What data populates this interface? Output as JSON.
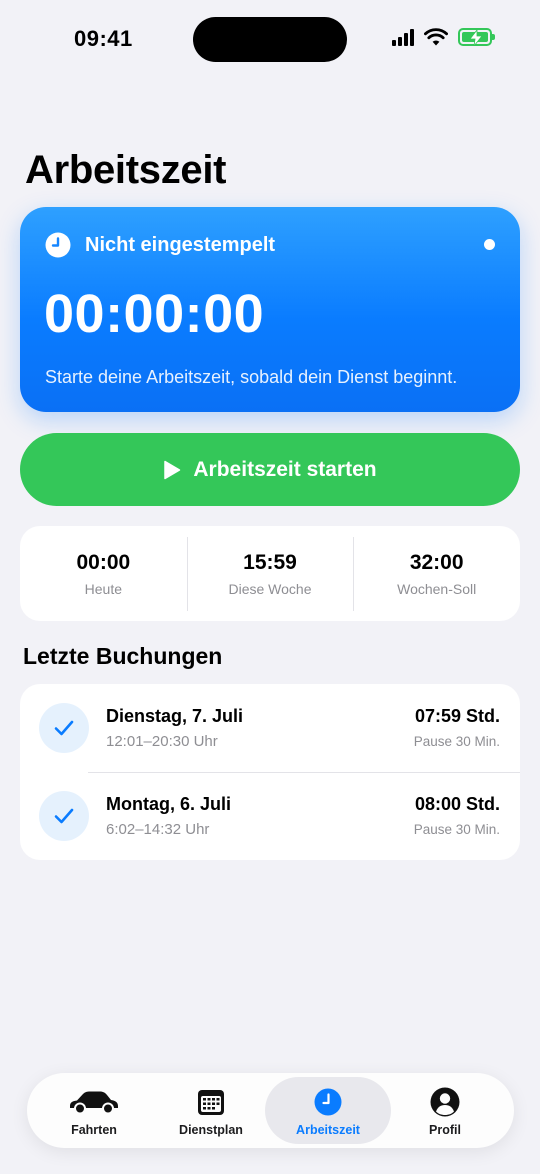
{
  "status_bar": {
    "time": "09:41"
  },
  "page": {
    "title": "Arbeitszeit"
  },
  "timer": {
    "status": "Nicht eingestempelt",
    "value": "00:00:00",
    "hint": "Starte deine Arbeitszeit, sobald dein Dienst beginnt."
  },
  "actions": {
    "start_label": "Arbeitszeit starten"
  },
  "stats": [
    {
      "value": "00:00",
      "label": "Heute"
    },
    {
      "value": "15:59",
      "label": "Diese Woche"
    },
    {
      "value": "32:00",
      "label": "Wochen-Soll"
    }
  ],
  "bookings": {
    "title": "Letzte Buchungen",
    "items": [
      {
        "date": "Dienstag, 7. Juli",
        "time": "12:01–20:30 Uhr",
        "hours": "07:59 Std.",
        "pause": "Pause 30 Min."
      },
      {
        "date": "Montag, 6. Juli",
        "time": "6:02–14:32 Uhr",
        "hours": "08:00 Std.",
        "pause": "Pause 30 Min."
      }
    ]
  },
  "tab_bar": {
    "tabs": [
      {
        "label": "Fahrten",
        "icon": "car-icon"
      },
      {
        "label": "Dienstplan",
        "icon": "calendar-icon"
      },
      {
        "label": "Arbeitszeit",
        "icon": "clock-icon",
        "active": true
      },
      {
        "label": "Profil",
        "icon": "person-icon"
      }
    ]
  },
  "colors": {
    "accent": "#0a7cff",
    "success": "#34c759",
    "background": "#f2f2f7"
  }
}
